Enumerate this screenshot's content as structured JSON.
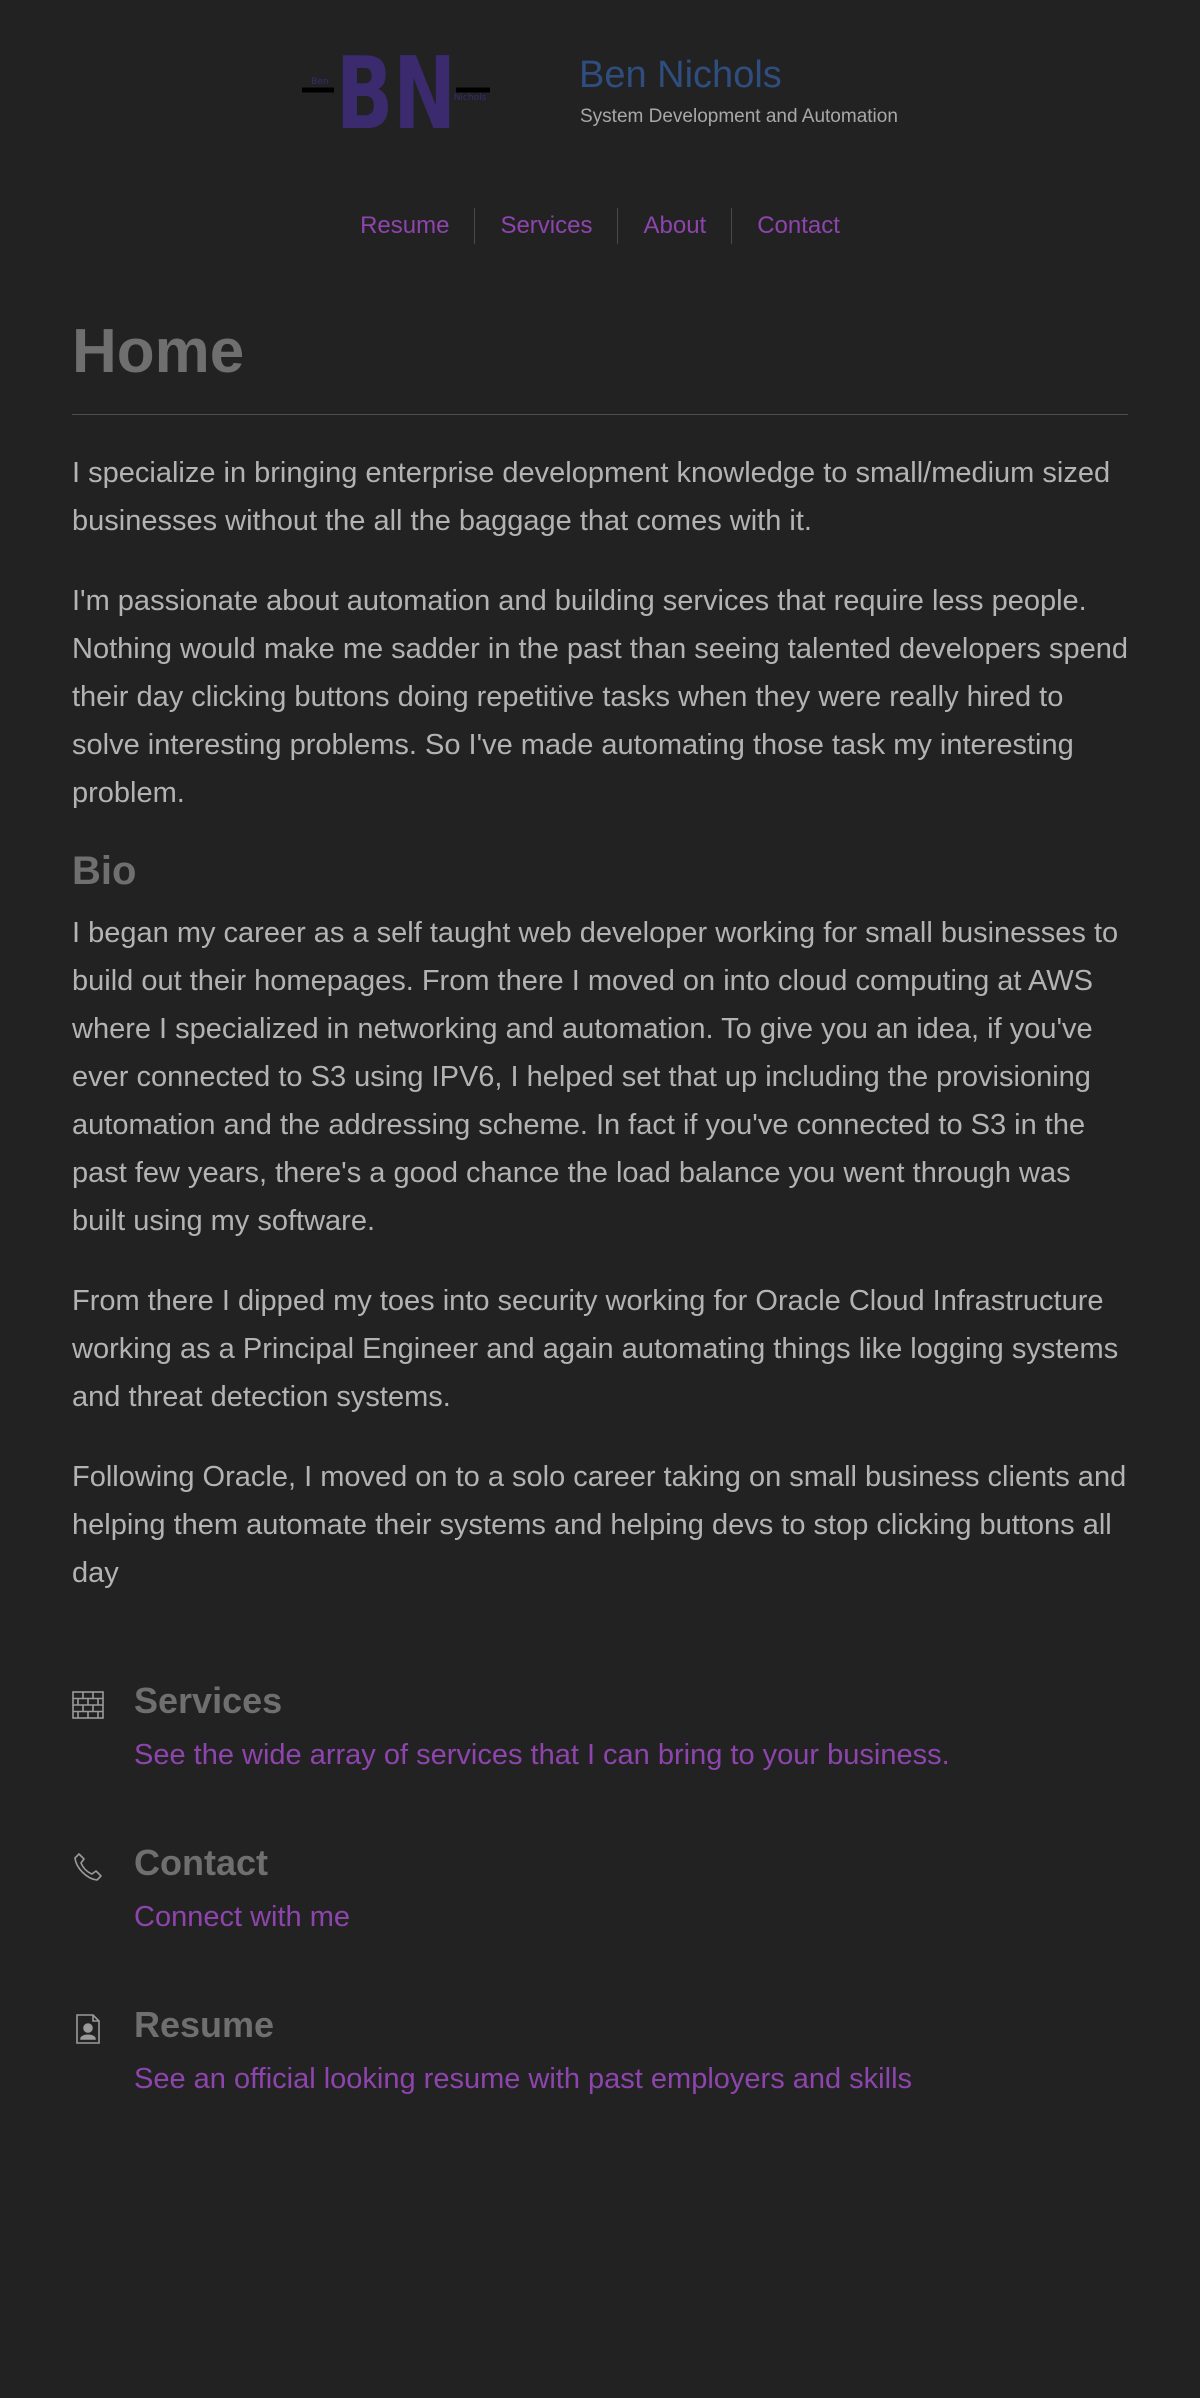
{
  "header": {
    "logo": {
      "letters": "BN",
      "first_name": "Ben",
      "last_name": "Nichols",
      "color": "#3b2a6e"
    },
    "title": "Ben Nichols",
    "tagline": "System Development and Automation"
  },
  "nav": {
    "items": [
      {
        "label": "Resume"
      },
      {
        "label": "Services"
      },
      {
        "label": "About"
      },
      {
        "label": "Contact"
      }
    ]
  },
  "main": {
    "title": "Home",
    "intro": [
      "I specialize in bringing enterprise development knowledge to small/medium sized businesses without the all the baggage that comes with it.",
      "I'm passionate about automation and building services that require less people. Nothing would make me sadder in the past than seeing talented developers spend their day clicking buttons doing repetitive tasks when they were really hired to solve interesting problems. So I've made automating those task my interesting problem."
    ],
    "bio_title": "Bio",
    "bio": [
      "I began my career as a self taught web developer working for small businesses to build out their homepages. From there I moved on into cloud computing at AWS where I specialized in networking and automation. To give you an idea, if you've ever connected to S3 using IPV6, I helped set that up including the provisioning automation and the addressing scheme. In fact if you've connected to S3 in the past few years, there's a good chance the load balance you went through was built using my software.",
      "From there I dipped my toes into security working for Oracle Cloud Infrastructure working as a Principal Engineer and again automating things like logging systems and threat detection systems.",
      "Following Oracle, I moved on to a solo career taking on small business clients and helping them automate their systems and helping devs to stop clicking buttons all day"
    ]
  },
  "features": [
    {
      "icon": "brick-wall-icon",
      "title": "Services",
      "link": "See the wide array of services that I can bring to your business."
    },
    {
      "icon": "phone-icon",
      "title": "Contact",
      "link": "Connect with me"
    },
    {
      "icon": "person-document-icon",
      "title": "Resume",
      "link": "See an official looking resume with past employers and skills"
    }
  ],
  "colors": {
    "background": "#222222",
    "accent": "#8e44ad",
    "title_blue": "#2f4d7e",
    "heading_gray": "#6f6f6f",
    "body_text": "#b3b3b3"
  }
}
